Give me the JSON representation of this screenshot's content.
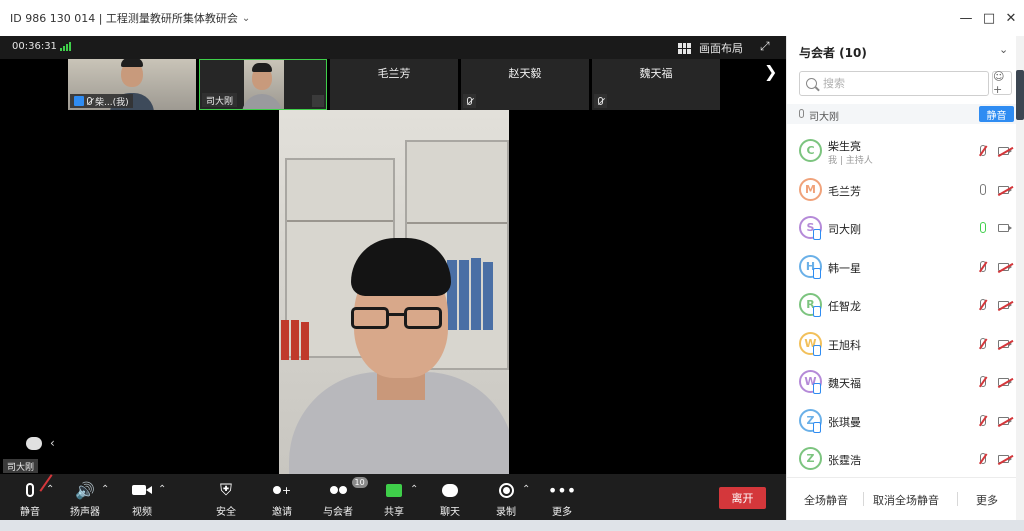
{
  "window": {
    "title": "ID 986 130 014 | 工程测量教研所集体教研会",
    "controls": [
      "minimize",
      "maximize",
      "close"
    ]
  },
  "topbar": {
    "timer": "00:36:31",
    "layout_label": "画面布局"
  },
  "thumbnails": [
    {
      "name": "柴...(我)",
      "has_video": true,
      "muted": true
    },
    {
      "name": "司大刚",
      "has_video": true,
      "muted": false,
      "active": true
    },
    {
      "name": "毛兰芳",
      "has_video": false,
      "muted": false
    },
    {
      "name": "赵天毅",
      "has_video": false,
      "muted": true
    },
    {
      "name": "魏天福",
      "has_video": false,
      "muted": true
    }
  ],
  "main_video": {
    "speaker": "司大刚"
  },
  "toolbar": {
    "mute": "静音",
    "speaker": "扬声器",
    "video": "视频",
    "security": "安全",
    "invite": "邀请",
    "participants": "与会者",
    "participants_count": "10",
    "share": "共享",
    "chat": "聊天",
    "record": "录制",
    "more": "更多",
    "leave": "离开"
  },
  "panel": {
    "title": "与会者 (10)",
    "search_placeholder": "搜索",
    "speaking": "司大刚",
    "mute_button": "静音",
    "participants": [
      {
        "name": "柴生亮",
        "sub": "我 | 主持人",
        "initial": "C",
        "color": "#7cc47f",
        "mic": "off",
        "cam": "off",
        "device": false
      },
      {
        "name": "毛兰芳",
        "sub": "",
        "initial": "M",
        "color": "#f0a27a",
        "mic": "on",
        "cam": "off",
        "device": false
      },
      {
        "name": "司大刚",
        "sub": "",
        "initial": "S",
        "color": "#b58ad8",
        "mic": "active",
        "cam": "on",
        "device": true
      },
      {
        "name": "韩一星",
        "sub": "",
        "initial": "H",
        "color": "#6ab0e8",
        "mic": "off",
        "cam": "off",
        "device": true
      },
      {
        "name": "任智龙",
        "sub": "",
        "initial": "R",
        "color": "#7cc47f",
        "mic": "off",
        "cam": "off",
        "device": true
      },
      {
        "name": "王旭科",
        "sub": "",
        "initial": "W",
        "color": "#f2c05a",
        "mic": "off",
        "cam": "off",
        "device": true
      },
      {
        "name": "魏天福",
        "sub": "",
        "initial": "W",
        "color": "#b58ad8",
        "mic": "off",
        "cam": "off",
        "device": true
      },
      {
        "name": "张琪曼",
        "sub": "",
        "initial": "Z",
        "color": "#6ab0e8",
        "mic": "off",
        "cam": "off",
        "device": true
      },
      {
        "name": "张霆浩",
        "sub": "",
        "initial": "Z",
        "color": "#7cc47f",
        "mic": "off",
        "cam": "off",
        "device": false
      }
    ],
    "footer": {
      "mute_all": "全场静音",
      "unmute_all": "取消全场静音",
      "more": "更多"
    }
  },
  "colors": {
    "accent": "#2f8cf2",
    "leave": "#d4373b",
    "signal": "#3fcf4a",
    "mic_active": "#3fcf4a",
    "mic_off": "#d4373b"
  }
}
